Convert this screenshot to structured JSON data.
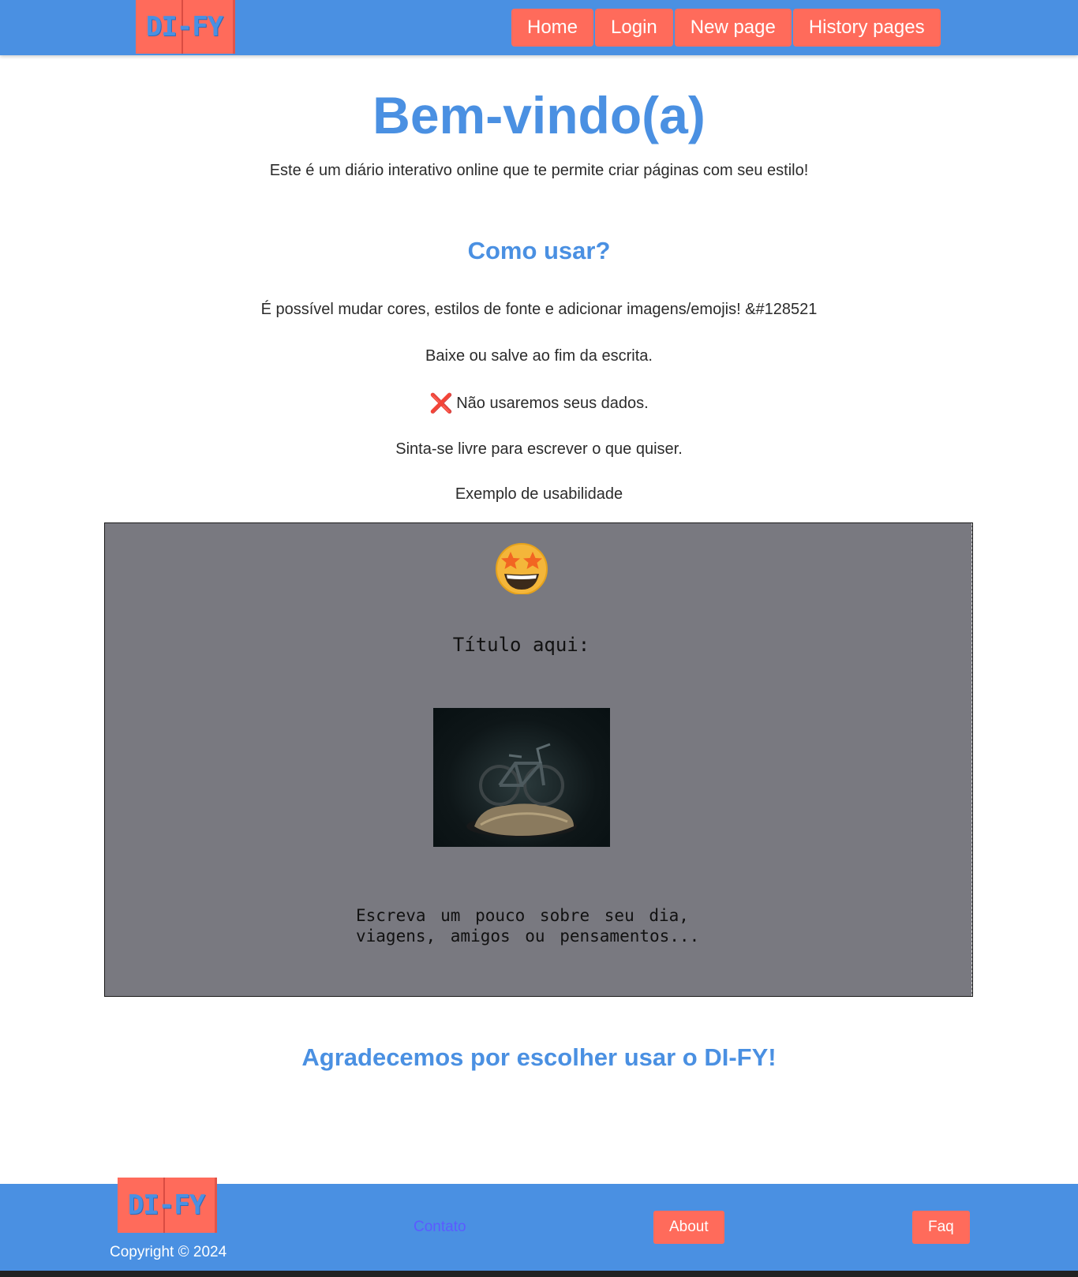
{
  "header": {
    "logo_text": "DI-FY",
    "nav": [
      "Home",
      "Login",
      "New page",
      "History pages"
    ]
  },
  "main": {
    "title": "Bem-vindo(a)",
    "subtitle": "Este é um diário interativo online que te permite criar páginas com seu estilo!",
    "how_title": "Como usar?",
    "paragraphs": [
      "É possível mudar cores, estilos de fonte e adicionar imagens/emojis! &#128521",
      "Baixe ou salve ao fim da escrita.",
      "Não usaremos seus dados.",
      "Sinta-se livre para escrever o que quiser.",
      "Exemplo de usabilidade"
    ],
    "x_icon": "❌",
    "example": {
      "emoji": "star-struck-emoji",
      "title": "Título aqui:",
      "image": "bicycle-photo",
      "text": "Escreva um pouco sobre seu dia,\nviagens, amigos ou pensamentos..."
    },
    "thanks": "Agradecemos por escolher usar o DI-FY!"
  },
  "footer": {
    "logo_text": "DI-FY",
    "copyright": "Copyright © 2024",
    "contact": "Contato",
    "about": "About",
    "faq": "Faq"
  },
  "colors": {
    "primary": "#4a90e2",
    "accent": "#ff6b5b",
    "example_bg": "#797980"
  }
}
